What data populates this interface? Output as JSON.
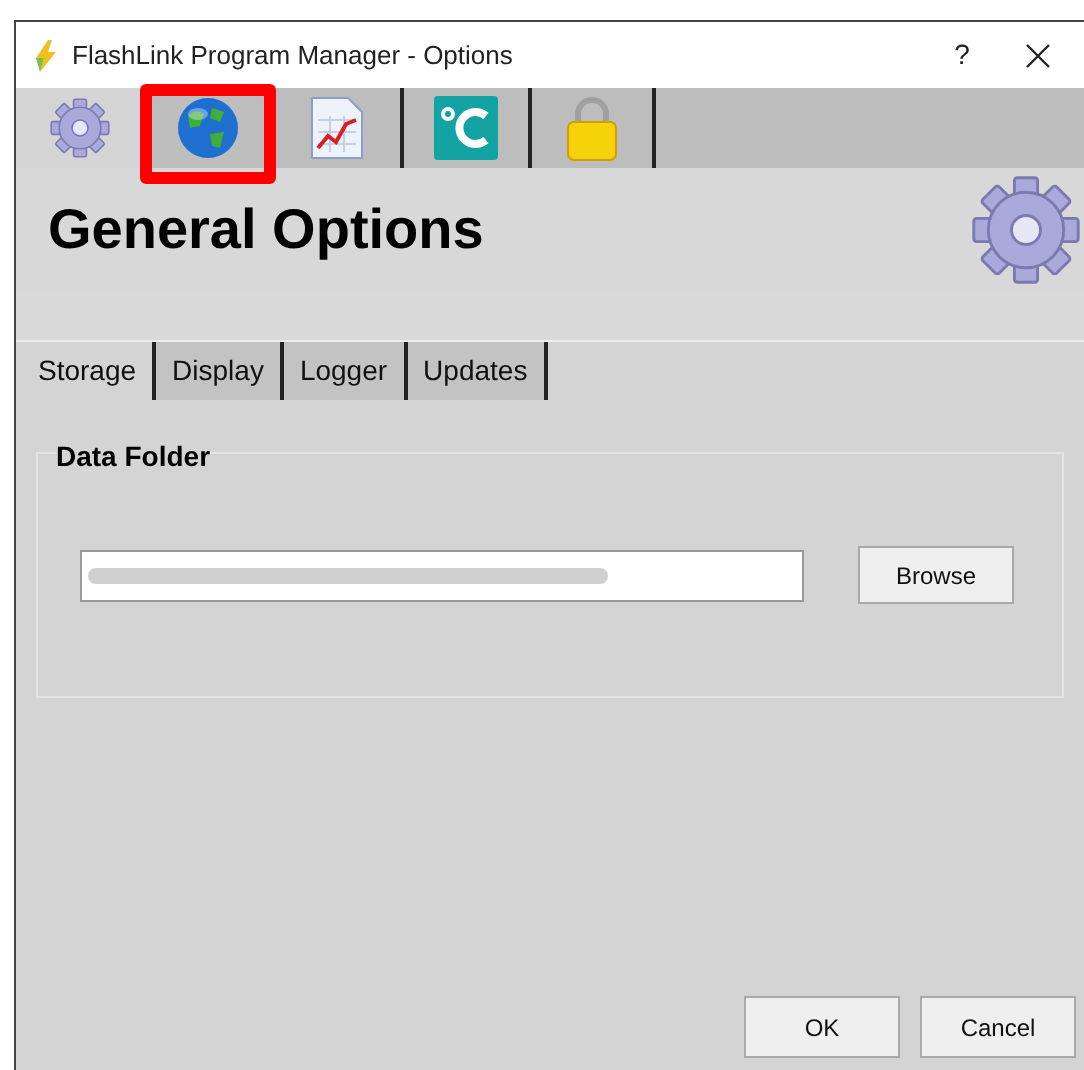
{
  "window": {
    "title": "FlashLink Program Manager - Options",
    "help": "?"
  },
  "toolbar": [
    {
      "kind": "gear",
      "selected": true,
      "highlighted": false
    },
    {
      "kind": "globe",
      "selected": false,
      "highlighted": true
    },
    {
      "kind": "chart",
      "selected": false,
      "highlighted": false
    },
    {
      "kind": "celsius",
      "selected": false,
      "highlighted": false
    },
    {
      "kind": "lock",
      "selected": false,
      "highlighted": false
    }
  ],
  "header": {
    "title": "General Options"
  },
  "tabs": [
    {
      "label": "Storage",
      "selected": true
    },
    {
      "label": "Display",
      "selected": false
    },
    {
      "label": "Logger",
      "selected": false
    },
    {
      "label": "Updates",
      "selected": false
    }
  ],
  "data_folder": {
    "title": "Data Folder",
    "browse": "Browse"
  },
  "buttons": [
    "OK",
    "Cancel"
  ]
}
